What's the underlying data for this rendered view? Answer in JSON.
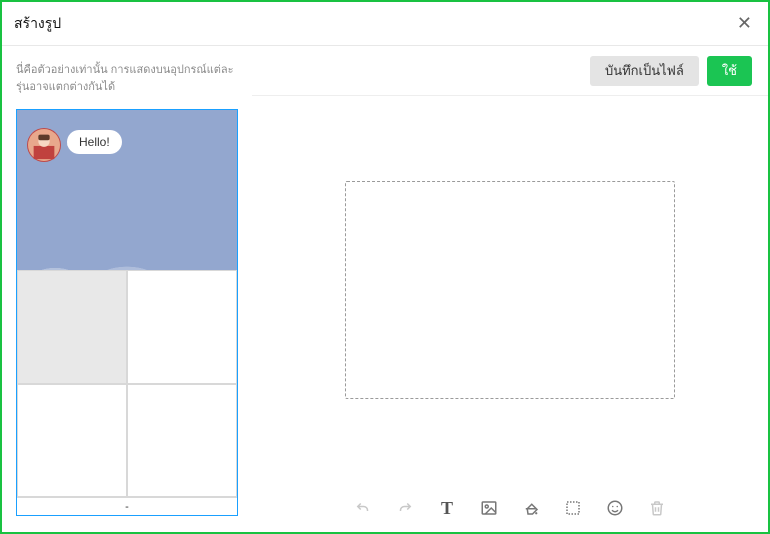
{
  "header": {
    "title": "สร้างรูป"
  },
  "left": {
    "hint": "นี่คือตัวอย่างเท่านั้น การแสดงบนอุปกรณ์แต่ละรุ่นอาจแตกต่างกันได้",
    "preview_message": "Hello!",
    "grid_chin": "-"
  },
  "actions": {
    "save_as_file": "บันทึกเป็นไฟล์",
    "use": "ใช้"
  },
  "toolbar": {
    "undo": "undo",
    "redo": "redo",
    "text": "T",
    "image": "image",
    "fill": "fill",
    "border": "border",
    "emoji": "emoji",
    "delete": "delete"
  }
}
